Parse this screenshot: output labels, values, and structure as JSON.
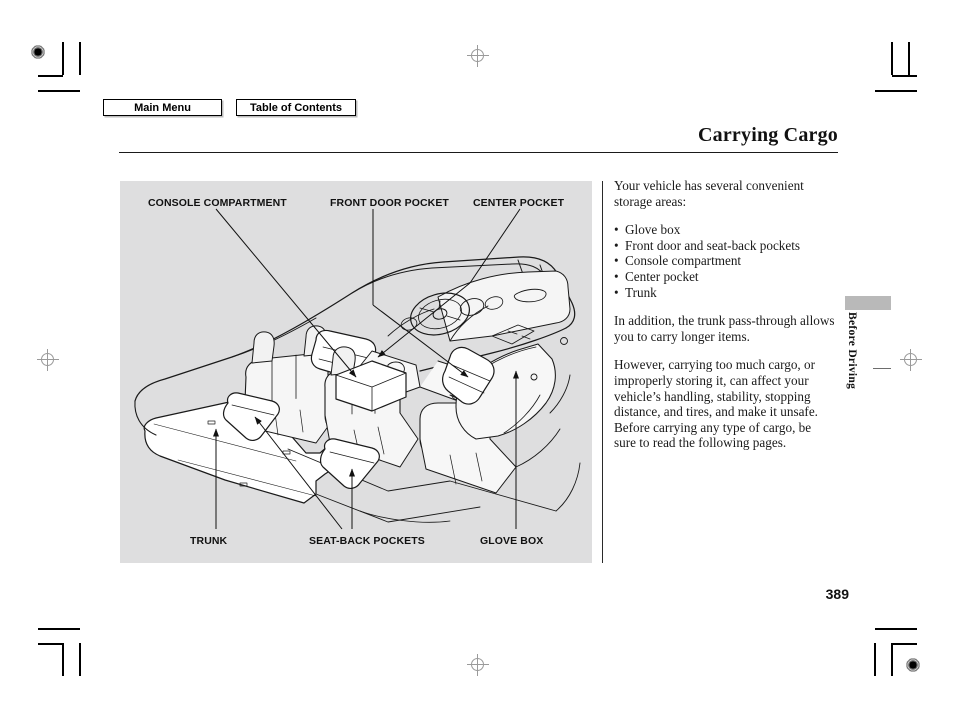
{
  "document": {
    "chapter_title": "Carrying Cargo",
    "page_number": "389",
    "side_tab_label": "Before Driving"
  },
  "navbar": {
    "main_menu_label": "Main Menu",
    "table_of_contents_label": "Table of Contents"
  },
  "figure": {
    "labels": {
      "console_compartment": "CONSOLE COMPARTMENT",
      "front_door_pocket": "FRONT DOOR POCKET",
      "center_pocket": "CENTER POCKET",
      "trunk": "TRUNK",
      "seat_back_pockets": "SEAT-BACK POCKETS",
      "glove_box": "GLOVE BOX"
    },
    "background_color": "#dededf",
    "line_color": "#1a1a1a",
    "highlight_color": "#ffffff",
    "caption_alt": "Cutaway line drawing of a car interior showing storage locations"
  },
  "body": {
    "intro": "Your vehicle has several convenient storage areas:",
    "storage_areas": [
      "Glove box",
      "Front door and seat-back pockets",
      "Console compartment",
      "Center pocket",
      "Trunk"
    ],
    "paragraph_2": "In addition, the trunk pass-through allows you to carry longer items.",
    "paragraph_3": "However, carrying too much cargo, or improperly storing it, can affect your vehicle’s handling, stability, stopping distance, and tires, and make it unsafe. Before carrying any type of cargo, be sure to read the following pages."
  }
}
